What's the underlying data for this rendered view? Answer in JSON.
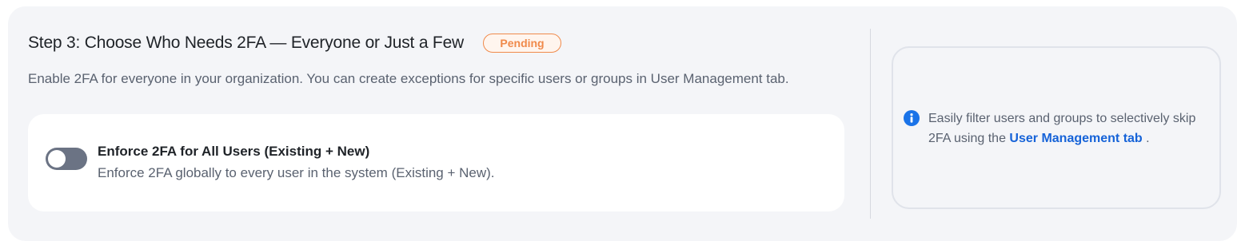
{
  "step": {
    "title": "Step 3: Choose Who Needs 2FA — Everyone or Just a Few",
    "status": "Pending",
    "description": "Enable 2FA for everyone in your organization. You can create exceptions for specific users or groups in User Management tab."
  },
  "option": {
    "title": "Enforce 2FA for All Users (Existing + New)",
    "description": "Enforce 2FA globally to every user in the system (Existing + New).",
    "toggle_on": false
  },
  "info": {
    "text_before": "Easily filter users and groups to selectively skip 2FA using the",
    "link_label": "User Management tab",
    "text_after": " .",
    "icon": "info-icon"
  },
  "colors": {
    "badge": "#f08a4b",
    "link": "#1663d8",
    "toggle_off": "#6b7384"
  }
}
